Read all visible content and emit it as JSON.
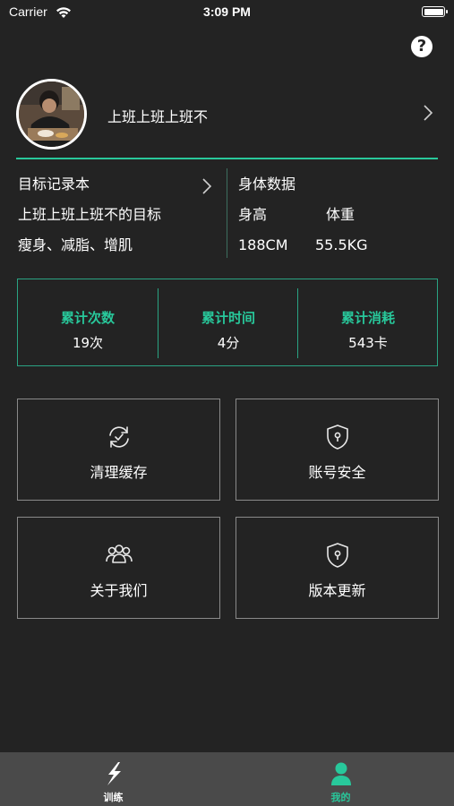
{
  "status_bar": {
    "carrier": "Carrier",
    "time": "3:09 PM",
    "battery_level": 1.0
  },
  "help_icon": "?",
  "profile": {
    "username": "上班上班上班不",
    "avatar_icon": "avatar-photo"
  },
  "goals": {
    "title": "目标记录本",
    "subtitle": "上班上班上班不的目标",
    "tags": "瘦身、减脂、增肌"
  },
  "body_data": {
    "title": "身体数据",
    "height_label": "身高",
    "weight_label": "体重",
    "height_value": "188CM",
    "weight_value": "55.5KG"
  },
  "stats": [
    {
      "label": "累计次数",
      "value": "19次"
    },
    {
      "label": "累计时间",
      "value": "4分"
    },
    {
      "label": "累计消耗",
      "value": "543卡"
    }
  ],
  "menu": [
    {
      "label": "清理缓存",
      "icon": "refresh-icon"
    },
    {
      "label": "账号安全",
      "icon": "shield-lock-icon"
    },
    {
      "label": "关于我们",
      "icon": "group-icon"
    },
    {
      "label": "版本更新",
      "icon": "shield-lock-icon"
    }
  ],
  "tabs": [
    {
      "label": "训练",
      "icon": "lightning-icon",
      "active": false
    },
    {
      "label": "我的",
      "icon": "person-icon",
      "active": true
    }
  ],
  "colors": {
    "background": "#232323",
    "accent": "#28c89b",
    "tabbar": "#4a4a4a",
    "tile_border": "#8a8a8a"
  }
}
